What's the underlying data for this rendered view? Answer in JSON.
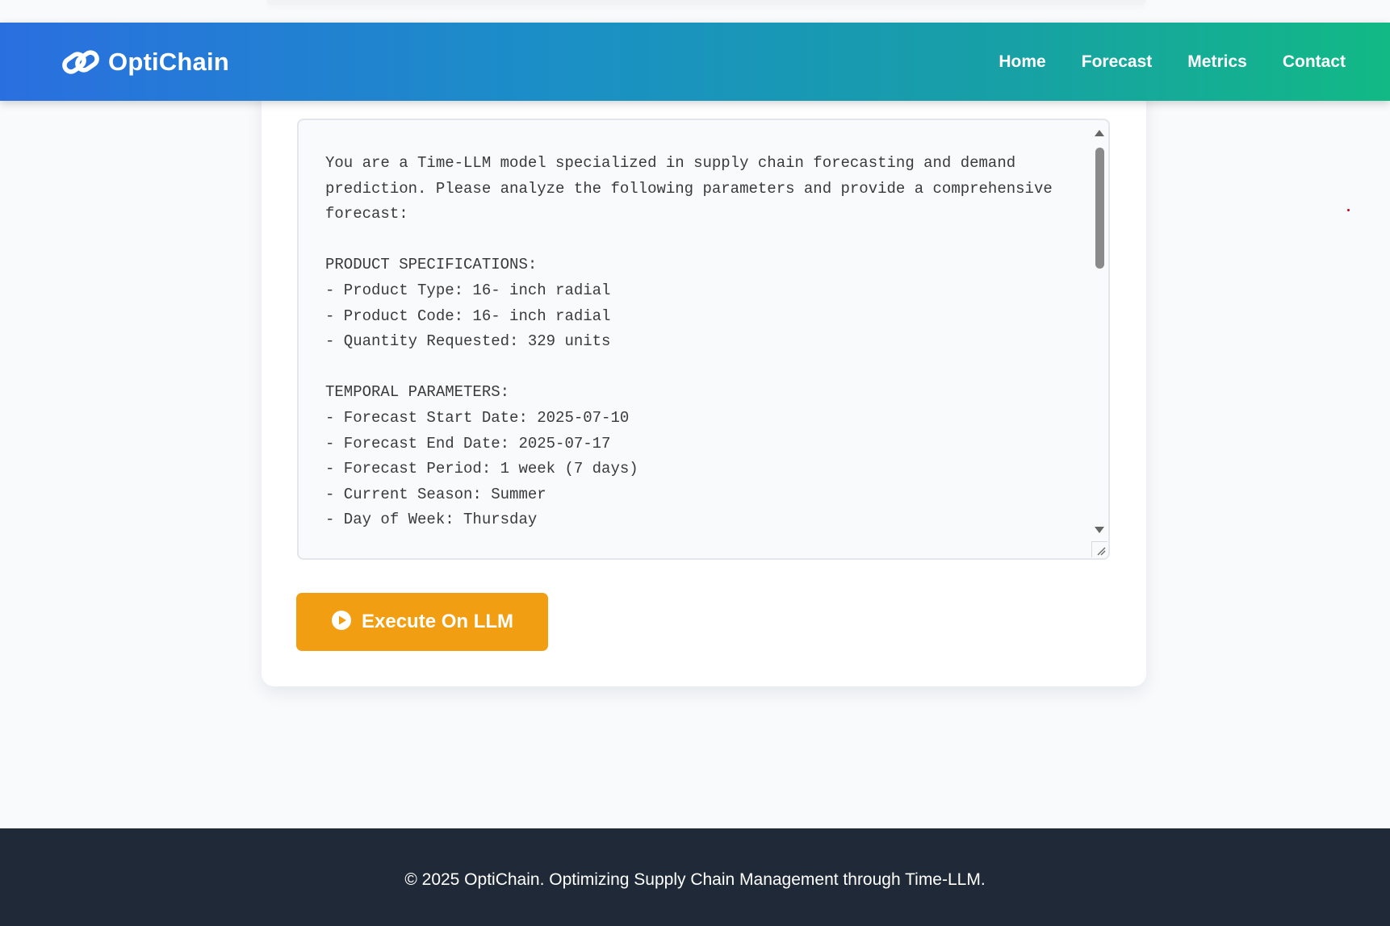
{
  "navbar": {
    "brand_name": "OptiChain",
    "links": [
      "Home",
      "Forecast",
      "Metrics",
      "Contact"
    ]
  },
  "prompt": {
    "text": "You are a Time-LLM model specialized in supply chain forecasting and demand prediction. Please analyze the following parameters and provide a comprehensive forecast:\n\nPRODUCT SPECIFICATIONS:\n- Product Type: 16- inch radial\n- Product Code: 16- inch radial\n- Quantity Requested: 329 units\n\nTEMPORAL PARAMETERS:\n- Forecast Start Date: 2025-07-10\n- Forecast End Date: 2025-07-17\n- Forecast Period: 1 week (7 days)\n- Current Season: Summer\n- Day of Week: Thursday"
  },
  "execute_button": {
    "label": "Execute On LLM",
    "icon": "play-circle-icon"
  },
  "footer": {
    "text": "© 2025 OptiChain. Optimizing Supply Chain Management through Time-LLM."
  },
  "colors": {
    "nav_gradient_start": "#2a6fe0",
    "nav_gradient_end": "#12b985",
    "button": "#f29e12",
    "footer_bg": "#1f2937"
  }
}
